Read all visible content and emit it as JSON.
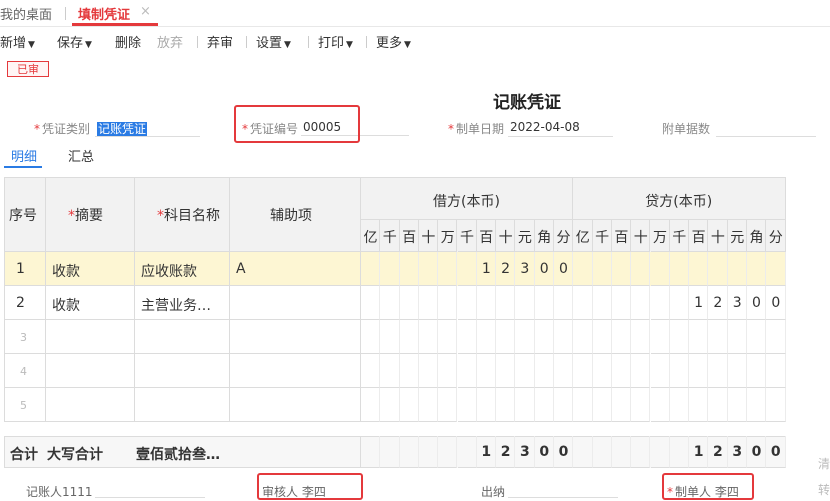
{
  "tabs": {
    "home": "我的桌面",
    "active": "填制凭证",
    "close": "×"
  },
  "toolbar": {
    "new": "新增",
    "save": "保存",
    "delete": "删除",
    "discard": "放弃",
    "unaudit": "弃审",
    "settings": "设置",
    "print": "打印",
    "more": "更多"
  },
  "status_badge": "已审",
  "voucher_title": "记账凭证",
  "header": {
    "type_label": "凭证类别",
    "type_value": "记账凭证",
    "number_label": "凭证编号",
    "number_value": "00005",
    "date_label": "制单日期",
    "date_value": "2022-04-08",
    "attachments_label": "附单据数",
    "attachments_value": ""
  },
  "subtabs": {
    "detail": "明细",
    "summary": "汇总"
  },
  "table": {
    "col_seq": "序号",
    "col_summary": "摘要",
    "col_account": "科目名称",
    "col_aux": "辅助项",
    "debit_header": "借方(本币)",
    "credit_header": "贷方(本币)",
    "digit_units": [
      "亿",
      "千",
      "百",
      "十",
      "万",
      "千",
      "百",
      "十",
      "元",
      "角",
      "分"
    ],
    "rows": [
      {
        "seq": "1",
        "summary": "收款",
        "account": "应收账款",
        "aux": "A",
        "debit": [
          "",
          "",
          "",
          "",
          "",
          "",
          "1",
          "2",
          "3",
          "0",
          "0"
        ],
        "credit": [
          "",
          "",
          "",
          "",
          "",
          "",
          "",
          "",
          "",
          "",
          ""
        ]
      },
      {
        "seq": "2",
        "summary": "收款",
        "account": "主营业务…",
        "aux": "",
        "debit": [
          "",
          "",
          "",
          "",
          "",
          "",
          "",
          "",
          "",
          "",
          ""
        ],
        "credit": [
          "",
          "",
          "",
          "",
          "",
          "",
          "1",
          "2",
          "3",
          "0",
          "0"
        ]
      },
      {
        "seq": "3",
        "summary": "",
        "account": "",
        "aux": "",
        "debit": [
          "",
          "",
          "",
          "",
          "",
          "",
          "",
          "",
          "",
          "",
          ""
        ],
        "credit": [
          "",
          "",
          "",
          "",
          "",
          "",
          "",
          "",
          "",
          "",
          ""
        ]
      },
      {
        "seq": "4",
        "summary": "",
        "account": "",
        "aux": "",
        "debit": [
          "",
          "",
          "",
          "",
          "",
          "",
          "",
          "",
          "",
          "",
          ""
        ],
        "credit": [
          "",
          "",
          "",
          "",
          "",
          "",
          "",
          "",
          "",
          "",
          ""
        ]
      },
      {
        "seq": "5",
        "summary": "",
        "account": "",
        "aux": "",
        "debit": [
          "",
          "",
          "",
          "",
          "",
          "",
          "",
          "",
          "",
          "",
          ""
        ],
        "credit": [
          "",
          "",
          "",
          "",
          "",
          "",
          "",
          "",
          "",
          "",
          ""
        ]
      }
    ],
    "total": {
      "label": "合计",
      "caps_label": "大写合计",
      "caps_value": "壹佰贰拾叁…",
      "debit": [
        "",
        "",
        "",
        "",
        "",
        "",
        "1",
        "2",
        "3",
        "0",
        "0"
      ],
      "credit": [
        "",
        "",
        "",
        "",
        "",
        "",
        "1",
        "2",
        "3",
        "0",
        "0"
      ]
    }
  },
  "footer": {
    "bookkeeper": "记账人1111",
    "reviewer": "审核人 李四",
    "cashier": "出纳",
    "maker": "制单人 李四"
  },
  "side_text": {
    "top": "清",
    "bottom": "转"
  },
  "colors": {
    "accent_red": "#e4393c",
    "accent_blue": "#2a7be4",
    "highlight_row": "#fdf6d3"
  }
}
